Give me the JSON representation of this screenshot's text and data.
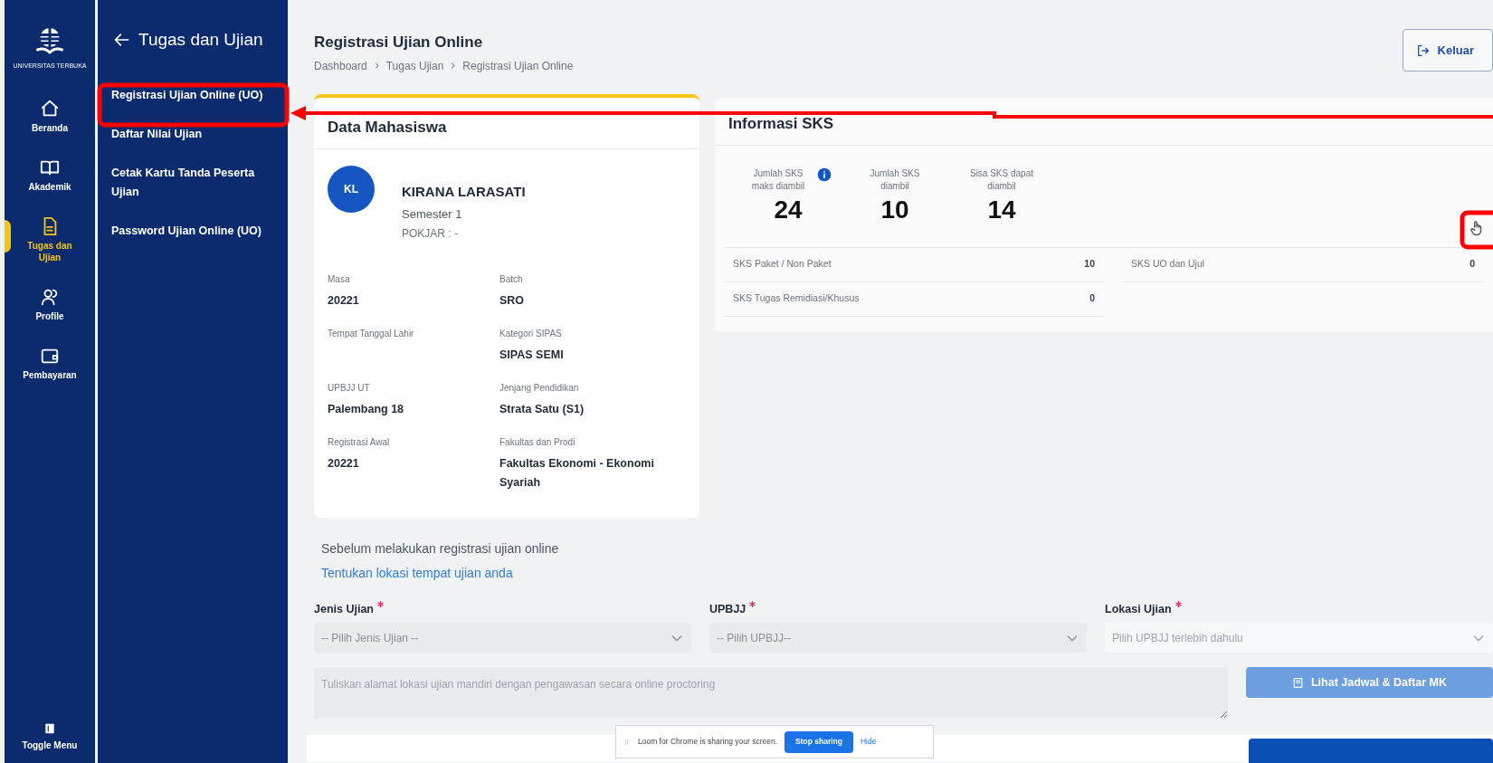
{
  "rail": {
    "logo_caption": "UNIVERSITAS TERBUKA",
    "items": [
      {
        "label": "Beranda",
        "selected": false
      },
      {
        "label": "Akademik",
        "selected": false
      },
      {
        "label": "Tugas dan Ujian",
        "selected": true
      },
      {
        "label": "Profile",
        "selected": false
      },
      {
        "label": "Pembayaran",
        "selected": false
      }
    ],
    "toggle": "Toggle Menu"
  },
  "submenu": {
    "title": "Tugas dan Ujian",
    "items": [
      "Registrasi Ujian Online (UO)",
      "Daftar Nilai Ujian",
      "Cetak Kartu Tanda Peserta Ujian",
      "Password Ujian Online (UO)"
    ]
  },
  "header": {
    "title": "Registrasi Ujian Online",
    "breadcrumb": [
      "Dashboard",
      "Tugas Ujian",
      "Registrasi Ujian Online"
    ],
    "logout": "Keluar"
  },
  "student": {
    "title": "Data Mahasiswa",
    "initials": "KL",
    "name": "KIRANA LARASATI",
    "semester": "Semester 1",
    "pokjar": "POKJAR : -",
    "fields": [
      {
        "label": "Masa",
        "value": "20221"
      },
      {
        "label": "Batch",
        "value": "SRO"
      },
      {
        "label": "Tempat Tanggal Lahir"
      },
      {
        "label": "Kategori SIPAS",
        "value": "SIPAS SEMI"
      },
      {
        "label": "UPBJJ UT",
        "value": "Palembang 18"
      },
      {
        "label": "Jenjang Pendidikan",
        "value": "Strata Satu (S1)"
      },
      {
        "label": "Registrasi Awal",
        "value": "20221"
      },
      {
        "label": "Fakultas dan Prodi",
        "value": "Fakultas Ekonomi - Ekonomi Syariah"
      }
    ]
  },
  "sks": {
    "title": "Informasi SKS",
    "stats": [
      {
        "label": "Jumlah SKS maks diambil",
        "value": "24",
        "info": true
      },
      {
        "label": "Jumlah SKS diambil",
        "value": "10",
        "info": false
      },
      {
        "label": "Sisa SKS dapat diambil",
        "value": "14",
        "info": false
      }
    ],
    "rows_left": [
      {
        "label": "SKS Paket / Non Paket",
        "value": "10"
      },
      {
        "label": "SKS Tugas Remidiasi/Khusus",
        "value": "0"
      }
    ],
    "rows_right": [
      {
        "label": "SKS UO dan Ujul",
        "value": "0"
      }
    ]
  },
  "form": {
    "intro": "Sebelum melakukan registrasi ujian online",
    "link": "Tentukan lokasi tempat ujian anda",
    "selects": [
      {
        "label": "Jenis Ujian",
        "required": true,
        "placeholder": "-- Pilih Jenis Ujian --",
        "disabled": false
      },
      {
        "label": "UPBJJ",
        "required": true,
        "placeholder": "-- Pilih UPBJJ--",
        "disabled": false
      },
      {
        "label": "Lokasi Ujian",
        "required": true,
        "placeholder": "Pilih UPBJJ terlebih dahulu",
        "disabled": true
      }
    ],
    "address_placeholder": "Tuliskan alamat lokasi ujian mandiri dengan pengawasan secara online proctoring",
    "button": {
      "label": "Lihat Jadwal & Daftar MK",
      "disabled": true
    }
  },
  "share_bar": {
    "text": "Loom for Chrome is sharing your screen.",
    "stop": "Stop sharing",
    "hide": "Hide"
  }
}
